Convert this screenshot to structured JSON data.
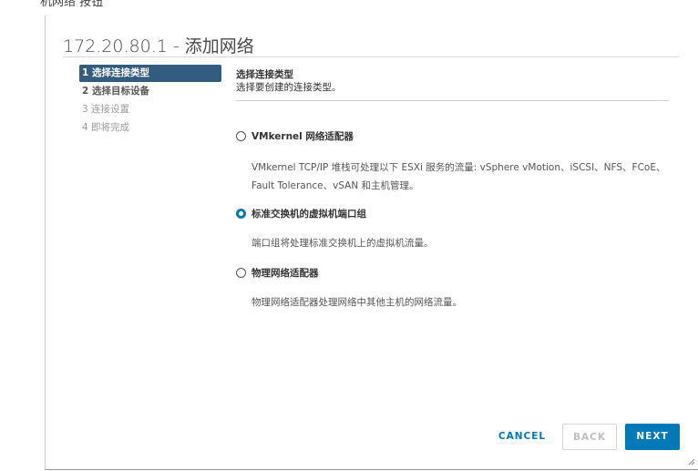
{
  "background_partial_title": "机网络 按钮",
  "dialog": {
    "title": "172.20.80.1 - 添加网络"
  },
  "steps": [
    {
      "label": "1 选择连接类型",
      "state": "active"
    },
    {
      "label": "2 选择目标设备",
      "state": "normal"
    },
    {
      "label": "3 连接设置",
      "state": "disabled"
    },
    {
      "label": "4 即将完成",
      "state": "disabled"
    }
  ],
  "content": {
    "title": "选择连接类型",
    "subtitle": "选择要创建的连接类型。"
  },
  "options": [
    {
      "label": "VMkernel 网络适配器",
      "description_line1": "VMkernel TCP/IP 堆栈可处理以下 ESXi 服务的流量: vSphere vMotion、iSCSI、NFS、FCoE、",
      "description_line2": "Fault Tolerance、vSAN 和主机管理。",
      "selected": false
    },
    {
      "label": "标准交换机的虚拟机端口组",
      "description_line1": "端口组将处理标准交换机上的虚拟机流量。",
      "selected": true
    },
    {
      "label": "物理网络适配器",
      "description_line1": "物理网络适配器处理网络中其他主机的网络流量。",
      "selected": false
    }
  ],
  "buttons": {
    "cancel": "CANCEL",
    "back": "BACK",
    "next": "NEXT"
  },
  "colors": {
    "accent": "#0079b8",
    "active_step": "#325c80"
  }
}
